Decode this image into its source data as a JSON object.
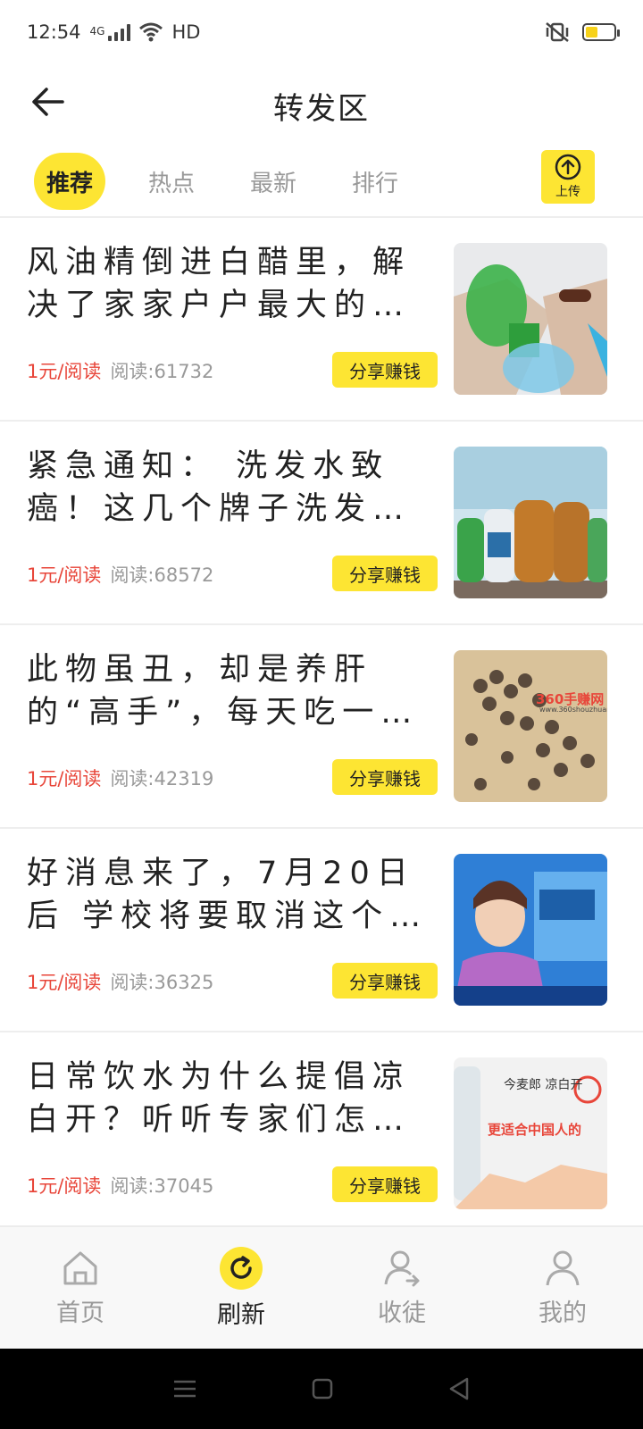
{
  "status": {
    "time": "12:54",
    "network": "4G",
    "hd": "HD"
  },
  "header": {
    "title": "转发区"
  },
  "tabs": [
    {
      "label": "推荐",
      "active": true
    },
    {
      "label": "热点",
      "active": false
    },
    {
      "label": "最新",
      "active": false
    },
    {
      "label": "排行",
      "active": false
    }
  ],
  "upload": {
    "label": "上传"
  },
  "articles": [
    {
      "title": "风油精倒进白醋里，解决了家家户户最大的…",
      "price": "1元/阅读",
      "reads": "阅读:61732",
      "share": "分享赚钱",
      "thumb": "bottle-thumbnail"
    },
    {
      "title": "紧急通知： 洗发水致癌！这几个牌子洗发…",
      "price": "1元/阅读",
      "reads": "阅读:68572",
      "share": "分享赚钱",
      "thumb": "shampoo-thumbnail"
    },
    {
      "title": "此物虽丑，却是养肝的“高手”，每天吃一…",
      "price": "1元/阅读",
      "reads": "阅读:42319",
      "share": "分享赚钱",
      "thumb": "seeds-thumbnail"
    },
    {
      "title": "好消息来了，7月20日后 学校将要取消这个…",
      "price": "1元/阅读",
      "reads": "阅读:36325",
      "share": "分享赚钱",
      "thumb": "news-anchor-thumbnail"
    },
    {
      "title": "日常饮水为什么提倡凉白开？听听专家们怎…",
      "price": "1元/阅读",
      "reads": "阅读:37045",
      "share": "分享赚钱",
      "thumb": "water-thumbnail"
    }
  ],
  "thumb_texts": {
    "watermark": "360手赚网",
    "watermark_url": "www.360shouzhuan.com",
    "water_brand": "今麦郎 凉白开",
    "water_slogan": "更适合中国人的"
  },
  "bottom_nav": [
    {
      "label": "首页",
      "icon": "home-icon",
      "active": false
    },
    {
      "label": "刷新",
      "icon": "refresh-icon",
      "active": true
    },
    {
      "label": "收徒",
      "icon": "add-disciple-icon",
      "active": false
    },
    {
      "label": "我的",
      "icon": "profile-icon",
      "active": false
    }
  ],
  "colors": {
    "accent": "#fde533",
    "price": "#e8463a",
    "muted": "#999999"
  }
}
